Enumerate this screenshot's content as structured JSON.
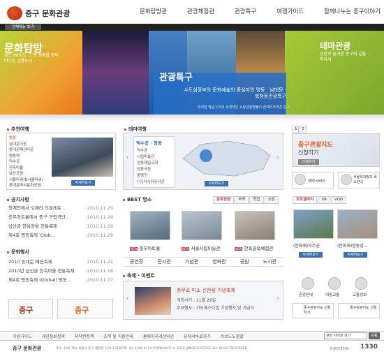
{
  "header": {
    "logo_text": "중구 문화관광",
    "nav": [
      "문화탐방관",
      "관광체험관",
      "관광특구",
      "여행가이드",
      "함께나누는 중구이야기"
    ],
    "all_menu": "전체메뉴 보기"
  },
  "banner": {
    "title1": "문화탐방",
    "sub1": "정도 600년, 그 옛 정취를 찾아 떠나는 전통도시",
    "title2": "관광특구",
    "sub2": "수도심장부의 문화예술의 중심지인 명동 · 남대문 · 북창동관광특구",
    "sub2b": "수려한 명승고적과 세계적인 쇼핑관광명물이 한데어우러진 중구",
    "title3": "테마관광",
    "sub3": "낭만과 즐거움 중구의 길을 따라서"
  },
  "recommend": {
    "title": "추천여행",
    "items": [
      "명동",
      "남대문시장",
      "동대문패션타운",
      "명동역",
      "덕수궁",
      "한옥마을",
      "남산공원",
      "서울타워(N서울타워)",
      "동대문역사문화공원"
    ],
    "more": "자세히보기"
  },
  "theme": {
    "title": "테마여행",
    "tab": "덕수궁 · 정동",
    "items": [
      "덕수궁",
      "시립미술관",
      "정동제일교회",
      "정동극장",
      "중명전",
      "(구)러시아공사관"
    ],
    "more": "자세히보기"
  },
  "map": {
    "title": "중구관광지도",
    "sub": "신청하기",
    "link": "신청하기"
  },
  "services": [
    {
      "label": "예약서비스"
    },
    {
      "label": "서울위치정보 목소안내"
    }
  ],
  "notice": {
    "title": "공지사항",
    "items": [
      {
        "t": "청계천에서 오페라 리골레토...",
        "d": "2010.11.29"
      },
      {
        "t": "충무아트홀에서 중구 구립극단...",
        "d": "2010.11.29"
      },
      {
        "t": "남산골 한옥마을 전통축제",
        "d": "2010.11.29"
      },
      {
        "t": "제4회 명동축제 'Glob...",
        "d": "2010.11.29"
      }
    ]
  },
  "best": {
    "title": "BEST 명소",
    "tabs": [
      "문화관광",
      "숙박",
      "맛집",
      "쇼핑"
    ],
    "items": [
      "충무아트홀",
      "서울시립미술관",
      "한옥골목체험관"
    ],
    "links": [
      "공연장",
      "전시관",
      "기념관",
      "영화관",
      "공원",
      "노시관"
    ]
  },
  "movie": {
    "tabs": [
      "포토갤러리",
      "VR",
      "VOD"
    ],
    "items": [
      "(문화재)덕수궁",
      "(문화재)명동성..."
    ],
    "more": "자세히보기"
  },
  "events": {
    "title": "문화행사",
    "items": [
      {
        "t": "2010 동대문 패션축제",
        "d": "2010.11.21"
      },
      {
        "t": "2010년 남산골 한옥마을 전통축제",
        "d": "2010.11.18"
      },
      {
        "t": "제4회 명동축제 (Global) 명동...",
        "d": "2010.11.07"
      }
    ]
  },
  "festival": {
    "title": "축제 · 이벤트",
    "headline": "충무로 미소 신한샘 기념축제",
    "period": "개최시기 : 11월 29일",
    "place": "주요행사 : 가요페스티벌 기념행사 및 기념식"
  },
  "quick": [
    "관광안내",
    "대중교통",
    "교통정보"
  ],
  "quick2": [
    "중구관광지도 신청하기",
    "중구관광지도 신청"
  ],
  "banners": [
    "중구",
    "중구"
  ],
  "footer": {
    "links": [
      "이용가이드",
      "개인정보정책",
      "저작권정책",
      "조직 및 직원안내",
      "홈페이지개선의견",
      "뷰에서바로가기",
      "키보드도움말"
    ],
    "select": "관련 사이트 보기",
    "go": "이동",
    "logo": "중구 문화관광",
    "address": "주소. 100-761 서울시 중구 예관동 120-1 대표전화. 02-3396-4114 COPYRIGHT © 2010 JUNGGU OFFICE ALL RIGHT RESERVED",
    "tourline_label": "관광안내전화",
    "tourline": "1330"
  },
  "colors": {
    "accent": "#e85a1a",
    "blue": "#2a6ec4",
    "green": "#8cb43a"
  }
}
